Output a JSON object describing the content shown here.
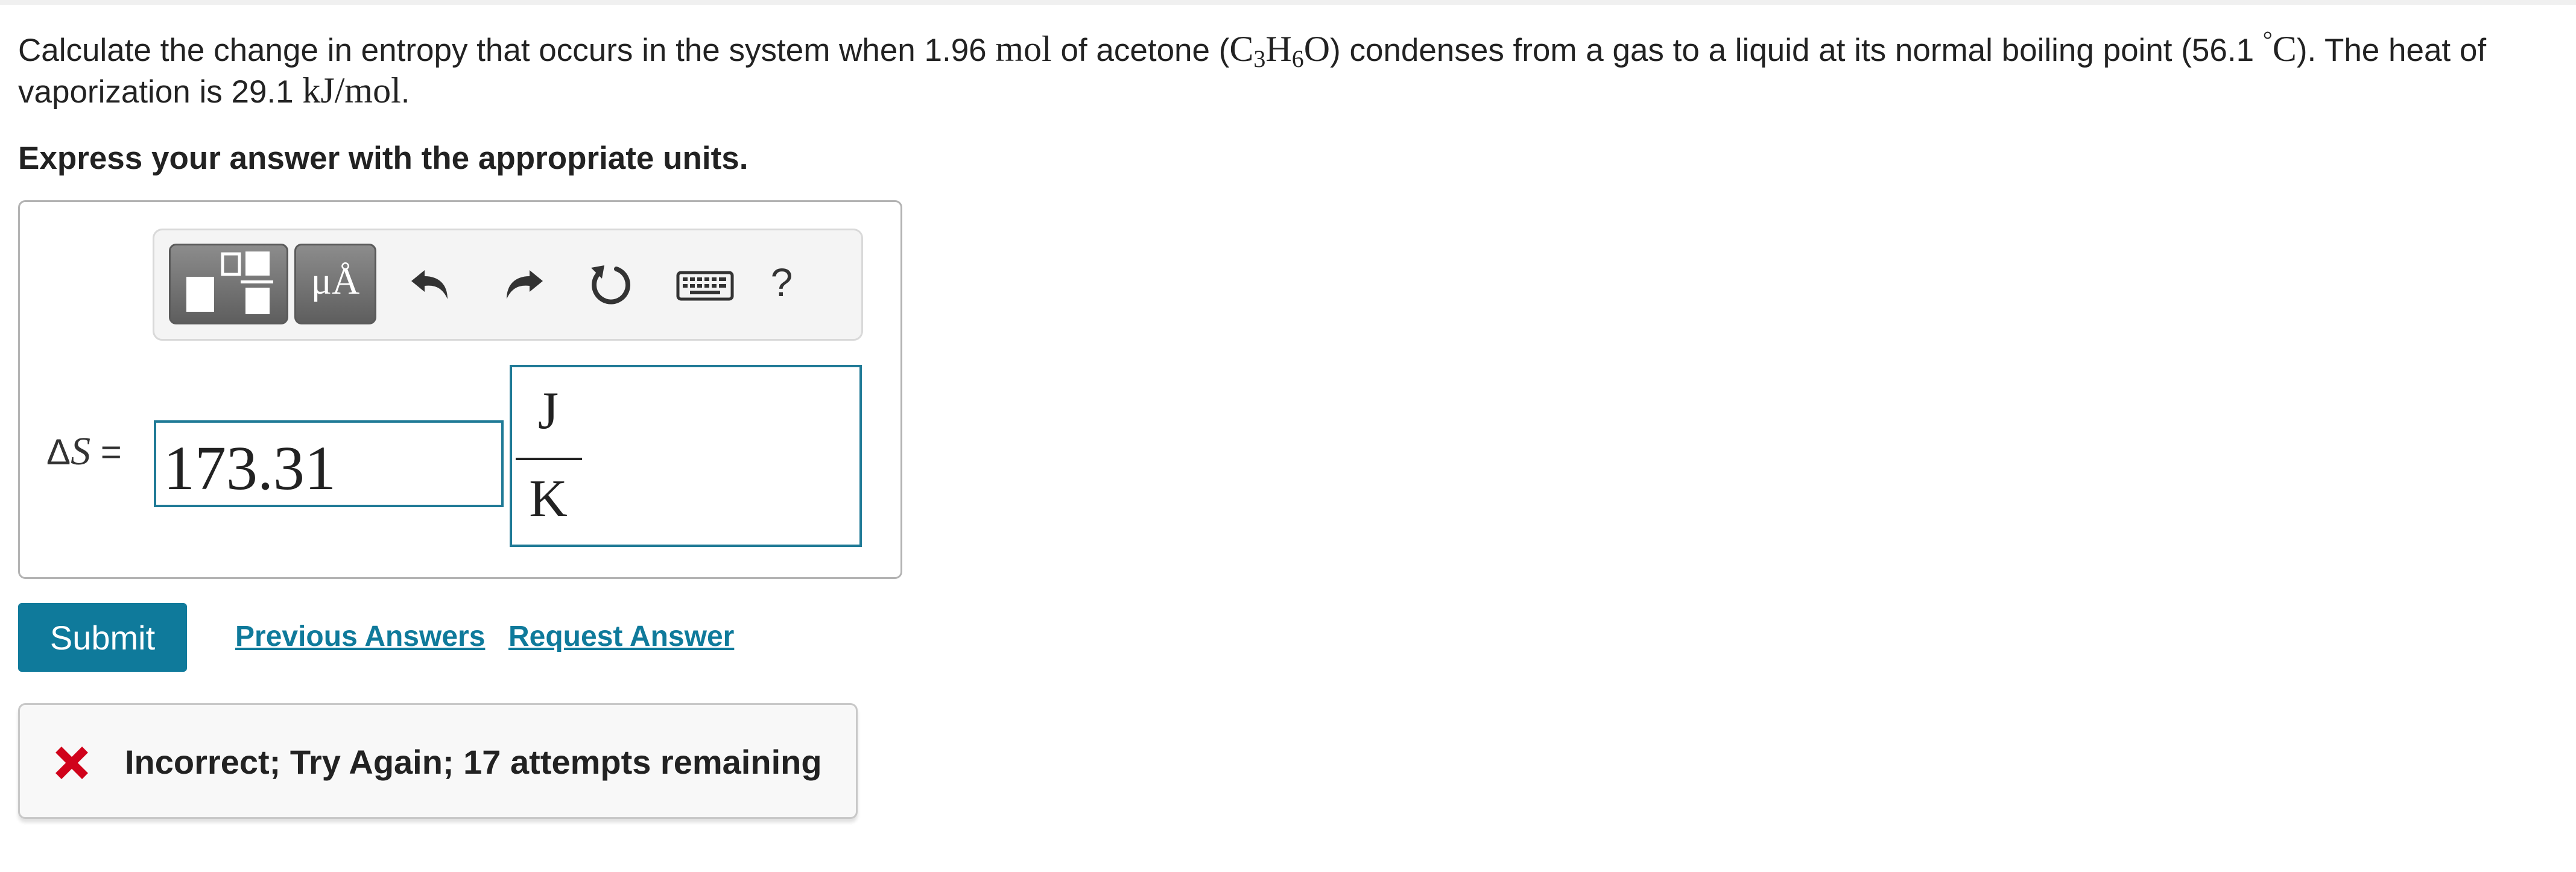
{
  "question": {
    "p1": "Calculate the change in entropy that occurs in the system when 1.96 ",
    "mol1": "mol",
    "p2": " of acetone (",
    "c": "C",
    "c_sub": "3",
    "h": "H",
    "h_sub": "6",
    "o": "O",
    "p3": ") condenses from a gas to a liquid at its normal boiling point (56.1 ",
    "degree": "°",
    "celsius": "C",
    "p4": "). The heat of vaporization is 29.1 ",
    "kj_mol": "kJ/mol",
    "p5": "."
  },
  "instruction": "Express your answer with the appropriate units.",
  "toolbar": {
    "templates_icon": "templates-icon",
    "units_label": "μÅ",
    "undo_icon": "undo-icon",
    "redo_icon": "redo-icon",
    "reset_icon": "reset-icon",
    "keyboard_icon": "keyboard-icon",
    "help_label": "?"
  },
  "answer": {
    "label_delta": "Δ",
    "label_var": "S",
    "label_eq": " = ",
    "value": "173.31",
    "unit_numerator": "J",
    "unit_denominator": "K"
  },
  "actions": {
    "submit": "Submit",
    "previous_answers": "Previous Answers",
    "request_answer": "Request Answer"
  },
  "feedback": {
    "icon": "x-icon",
    "message": "Incorrect; Try Again; 17 attempts remaining",
    "error_color": "#d0021b"
  },
  "colors": {
    "accent": "#0f7a9b",
    "input_border": "#1f7a96"
  }
}
